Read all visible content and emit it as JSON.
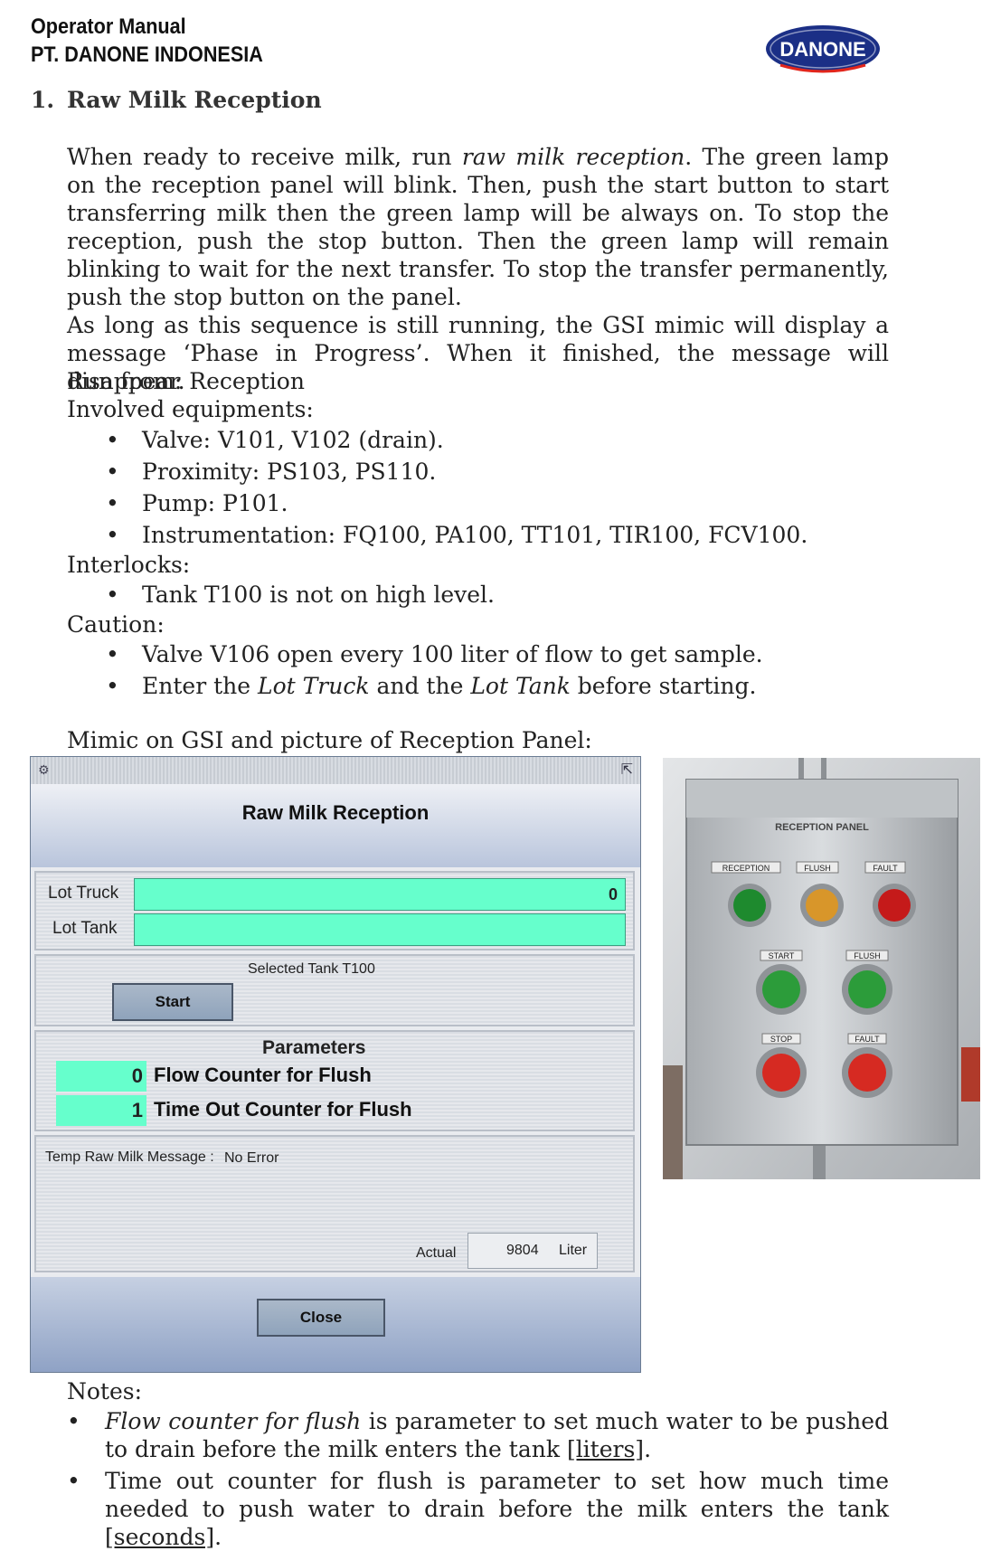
{
  "header": {
    "title": "Operator Manual",
    "company": "PT. DANONE INDONESIA",
    "logo_text": "DANONE"
  },
  "section": {
    "number": "1.",
    "title": "Raw Milk Reception"
  },
  "intro": {
    "p1_a": "When ready to receive milk, run ",
    "p1_em": "raw milk reception",
    "p1_b": ". The green lamp on the reception panel will blink. Then, push the start button to start transferring milk then the green lamp will be always on. To stop the reception, push the stop button. Then the green lamp will remain blinking to wait for the next transfer. To stop the transfer permanently, push the stop button on the panel.",
    "p2": "As long as this sequence is still running, the GSI mimic will display a message ‘Phase in Progress’. When it finished, the message will disappear."
  },
  "details": {
    "run_from": "Run from: Reception",
    "involved_label": "Involved equipments:",
    "involved": [
      "Valve: V101, V102 (drain).",
      "Proximity: PS103, PS110.",
      "Pump: P101.",
      "Instrumentation: FQ100, PA100, TT101, TIR100, FCV100."
    ],
    "interlocks_label": "Interlocks:",
    "interlocks": [
      "Tank T100 is not on high level."
    ],
    "caution_label": "Caution:",
    "caution_1": "Valve V106 open every 100 liter of flow to get sample.",
    "caution_2_a": "Enter the ",
    "caution_2_em1": "Lot Truck",
    "caution_2_b": " and the ",
    "caution_2_em2": "Lot Tank",
    "caution_2_c": " before starting.",
    "mimic_caption": "Mimic on GSI and picture of Reception Panel:"
  },
  "gsi": {
    "title": "Raw Milk Reception",
    "lot_truck_label": "Lot Truck",
    "lot_truck_value": "0",
    "lot_tank_label": "Lot Tank",
    "lot_tank_value": "",
    "selected_tank": "Selected Tank T100",
    "start_label": "Start",
    "parameters_label": "Parameters",
    "params": [
      {
        "value": "0",
        "label": "Flow Counter for Flush"
      },
      {
        "value": "1",
        "label": "Time Out Counter for Flush"
      }
    ],
    "message_label": "Temp Raw Milk Message :",
    "message_value": "No Error",
    "actual_label": "Actual",
    "actual_value": "9804",
    "actual_unit": "Liter",
    "close_label": "Close",
    "field_color": "#66ffcc"
  },
  "panel_photo": {
    "title": "RECEPTION PANEL",
    "lamp_labels": [
      "RECEPTION",
      "FLUSH",
      "FAULT"
    ],
    "lamp_colors": [
      "#1e8a2e",
      "#d8962a",
      "#c51a1a"
    ],
    "button_row1": [
      "START",
      "FLUSH"
    ],
    "button_row2": [
      "STOP",
      "FAULT"
    ],
    "button_colors_row1": [
      "#2c9c3a",
      "#2c9c3a"
    ],
    "button_colors_row2": [
      "#d62a22",
      "#d62a22"
    ]
  },
  "notes": {
    "label": "Notes:",
    "n1_em": "Flow counter for flush",
    "n1_a": " is parameter to set much water to be pushed to drain before the milk enters the tank ",
    "n1_unit": "[liters]",
    "n1_end": ".",
    "n2_a": "Time out counter for flush is parameter to set how much time needed to push water to drain before the milk enters the tank ",
    "n2_unit": "[seconds]",
    "n2_end": "."
  }
}
